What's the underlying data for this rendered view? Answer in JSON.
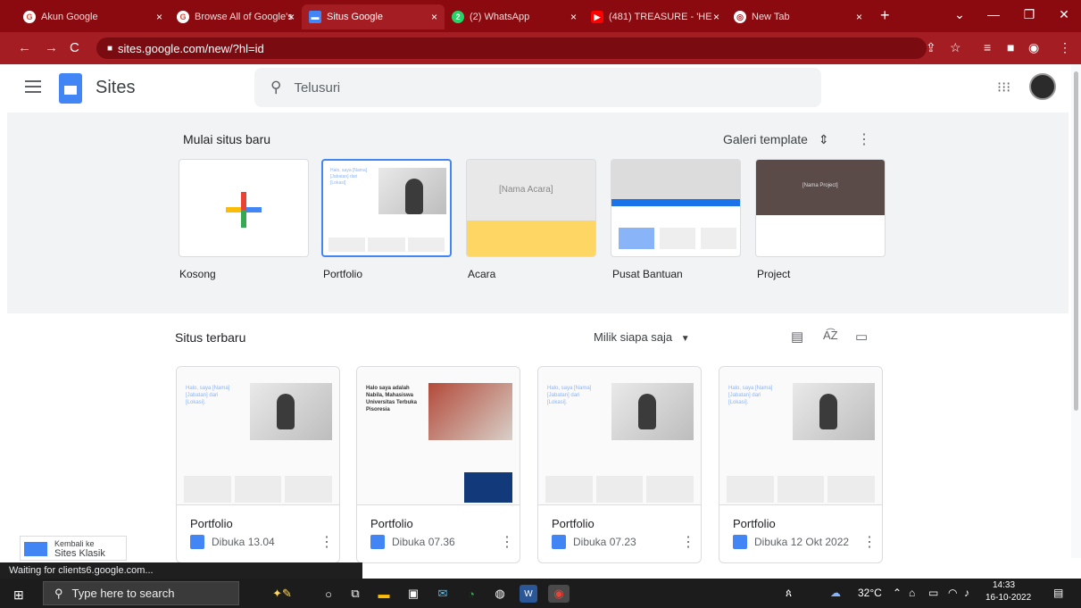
{
  "browser": {
    "tabs": [
      {
        "label": "Akun Google",
        "icon": "google-icon"
      },
      {
        "label": "Browse All of Google's",
        "icon": "google-icon"
      },
      {
        "label": "Situs Google",
        "icon": "sites-icon"
      },
      {
        "label": "(2) WhatsApp",
        "icon": "whatsapp-icon"
      },
      {
        "label": "(481) TREASURE - 'HE",
        "icon": "youtube-icon"
      },
      {
        "label": "New Tab",
        "icon": "newtab-icon"
      }
    ],
    "url": "sites.google.com/new/?hl=id",
    "colors": {
      "frame": "#8b0a0f",
      "toolbar": "#a31d22"
    }
  },
  "app": {
    "name": "Sites",
    "search_placeholder": "Telusuri"
  },
  "templates": {
    "title": "Mulai situs baru",
    "gallery_label": "Galeri template",
    "items": [
      {
        "label": "Kosong"
      },
      {
        "label": "Portfolio",
        "preview_text": "Halo, saya [Nama] [Jabatan] dari [Lokasi]"
      },
      {
        "label": "Acara",
        "preview_text": "[Nama Acara]"
      },
      {
        "label": "Pusat Bantuan"
      },
      {
        "label": "Project",
        "preview_text": "[Nama Project]"
      }
    ]
  },
  "recent": {
    "title": "Situs terbaru",
    "owner_filter": "Milik siapa saja",
    "sites": [
      {
        "name": "Portfolio",
        "opened": "Dibuka 13.04",
        "preview_text": "Halo, saya [Nama] [Jabatan] dari [Lokasi]."
      },
      {
        "name": "Portfolio",
        "opened": "Dibuka 07.36",
        "preview_text": "Halo saya adalah Nabila, Mahasiswa Universitas Terbuka Pisoresia"
      },
      {
        "name": "Portfolio",
        "opened": "Dibuka 07.23",
        "preview_text": "Halo, saya [Nama] [Jabatan] dari [Lokasi]."
      },
      {
        "name": "Portfolio",
        "opened": "Dibuka 12 Okt 2022",
        "preview_text": "Halo, saya [Nama] [Jabatan] dari [Lokasi]."
      }
    ]
  },
  "classic": {
    "line1": "Kembali ke",
    "line2": "Sites Klasik"
  },
  "status_text": "Waiting for clients6.google.com...",
  "taskbar": {
    "search_placeholder": "Type here to search",
    "weather": "32°C",
    "time": "14:33",
    "date": "16-10-2022"
  }
}
